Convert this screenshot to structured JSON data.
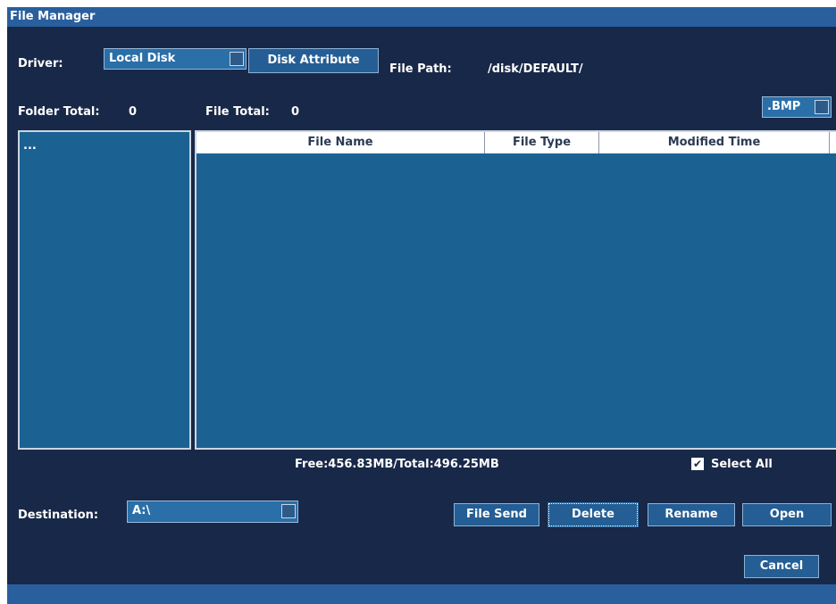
{
  "window": {
    "title": "File Manager"
  },
  "driver": {
    "label": "Driver:",
    "selected": "Local Disk",
    "attribute_button": "Disk Attribute",
    "path_label": "File Path:",
    "path_value": "/disk/DEFAULT/"
  },
  "totals": {
    "folder_label": "Folder Total:",
    "folder_count": "0",
    "file_label": "File Total:",
    "file_count": "0",
    "filter": ".BMP"
  },
  "folders": {
    "items": [
      "..."
    ]
  },
  "files": {
    "columns": [
      "File Name",
      "File Type",
      "Modified Time"
    ],
    "rows": []
  },
  "storage": {
    "summary": "Free:456.83MB/Total:496.25MB"
  },
  "select_all": {
    "label": "Select All",
    "checked": true
  },
  "destination": {
    "label": "Destination:",
    "selected": "A:\\"
  },
  "actions": {
    "file_send": "File Send",
    "delete": "Delete",
    "rename": "Rename",
    "open": "Open",
    "cancel": "Cancel"
  },
  "colors": {
    "background": "#182848",
    "title_bar": "#2a5f9e",
    "panel": "#1b6293",
    "button": "#245e95"
  }
}
